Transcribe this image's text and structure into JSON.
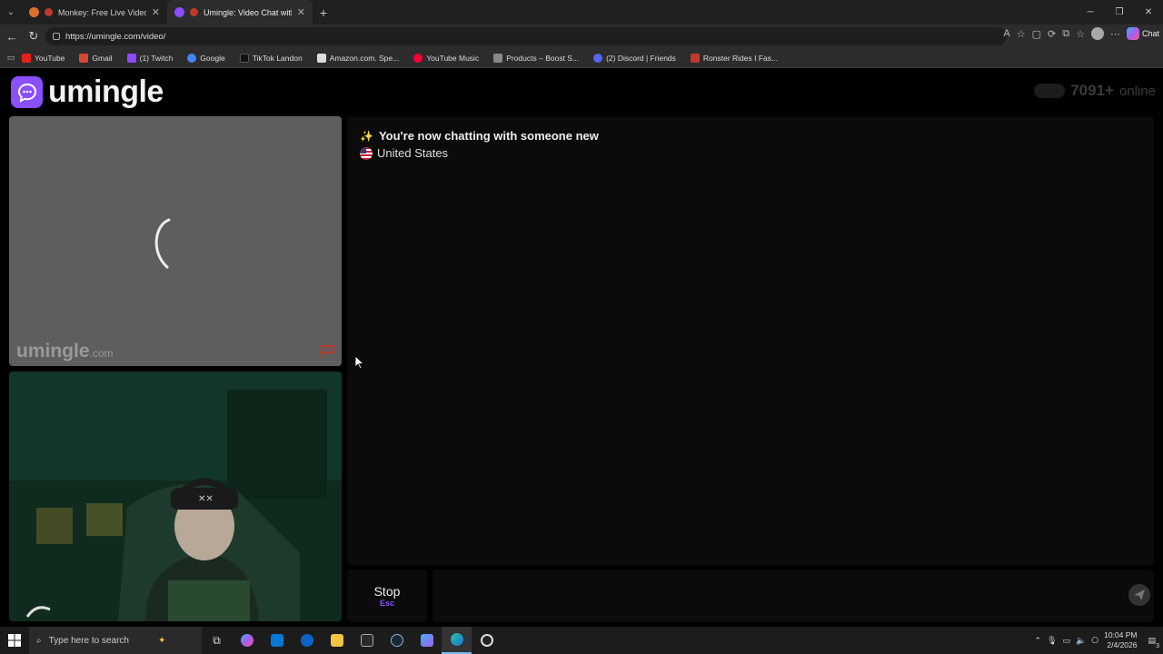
{
  "browser": {
    "tabs": [
      {
        "label": "Monkey: Free Live Video Chat",
        "active": false,
        "favicon_color": "#d9722c"
      },
      {
        "label": "Umingle: Video Chat with Stra",
        "active": true,
        "favicon_color": "#8a4fff"
      }
    ],
    "new_tab_label": "+",
    "url": "https://umingle.com/video/",
    "chat_label": "Chat",
    "bookmarks": [
      {
        "label": "YouTube",
        "color": "#e62117"
      },
      {
        "label": "Gmail",
        "color": "#d44638"
      },
      {
        "label": "(1) Twitch",
        "color": "#9146ff"
      },
      {
        "label": "Google",
        "color": "#4285f4"
      },
      {
        "label": "TikTok Landon",
        "color": "#111111"
      },
      {
        "label": "Amazon.com. Spe...",
        "color": "#dddddd"
      },
      {
        "label": "YouTube Music",
        "color": "#ff0033"
      },
      {
        "label": "Products – Boost S...",
        "color": "#888888"
      },
      {
        "label": "(2) Discord | Friends",
        "color": "#5865f2"
      },
      {
        "label": "Ronster Rides I Fas...",
        "color": "#c0392b"
      }
    ]
  },
  "site": {
    "logo_text": "umingle",
    "online_count": "7091+",
    "online_label": "online",
    "brand_color": "#8a4fff"
  },
  "stranger": {
    "watermark": "umingle",
    "watermark_suffix": ".com"
  },
  "chat": {
    "status_message": "You're now chatting with someone new",
    "country": "United States",
    "input_placeholder": ""
  },
  "controls": {
    "stop_label": "Stop",
    "stop_key": "Esc"
  },
  "taskbar": {
    "search_placeholder": "Type here to search",
    "time": "10:04 PM",
    "date": "2/4/2026",
    "notification_count": "3"
  }
}
